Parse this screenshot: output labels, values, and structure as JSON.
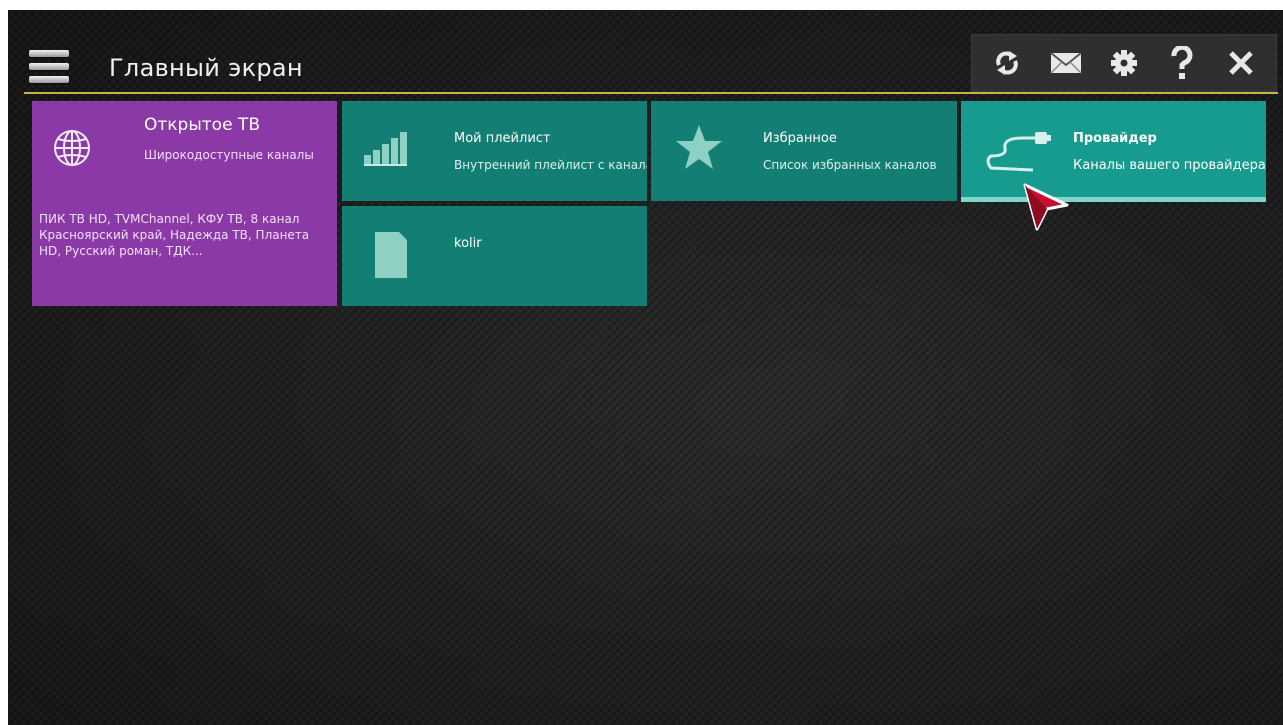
{
  "header": {
    "title": "Главный экран",
    "menu_icon": "hamburger-menu-icon",
    "toolbar": [
      {
        "name": "refresh-icon"
      },
      {
        "name": "mail-icon"
      },
      {
        "name": "gear-icon"
      },
      {
        "name": "help-icon"
      },
      {
        "name": "close-icon"
      }
    ]
  },
  "tiles": {
    "open_tv": {
      "title": "Открытое ТВ",
      "subtitle": "Широкодоступные каналы",
      "description": "ПИК ТВ HD, TVMChannel, КФУ ТВ, 8 канал Красноярский край, Надежда ТВ, Планета HD, Русский роман, ТДК...",
      "icon": "globe-icon",
      "color": "#8c39a8"
    },
    "my_playlist": {
      "title": "Мой плейлист",
      "subtitle": "Внутренний плейлист с каналами",
      "icon": "signal-bars-icon",
      "color": "#137f74"
    },
    "favorites": {
      "title": "Избранное",
      "subtitle": "Список избранных каналов",
      "icon": "star-icon",
      "color": "#137f74"
    },
    "provider": {
      "title": "Провайдер",
      "subtitle": "Каналы вашего провайдера",
      "icon": "cable-icon",
      "color": "#169b8e"
    },
    "kolir": {
      "title": "kolir",
      "icon": "file-icon",
      "color": "#137f74"
    }
  },
  "colors": {
    "accent_rule": "#c9b24a",
    "background": "#1e1e1e",
    "cursor": "#c8102e"
  }
}
